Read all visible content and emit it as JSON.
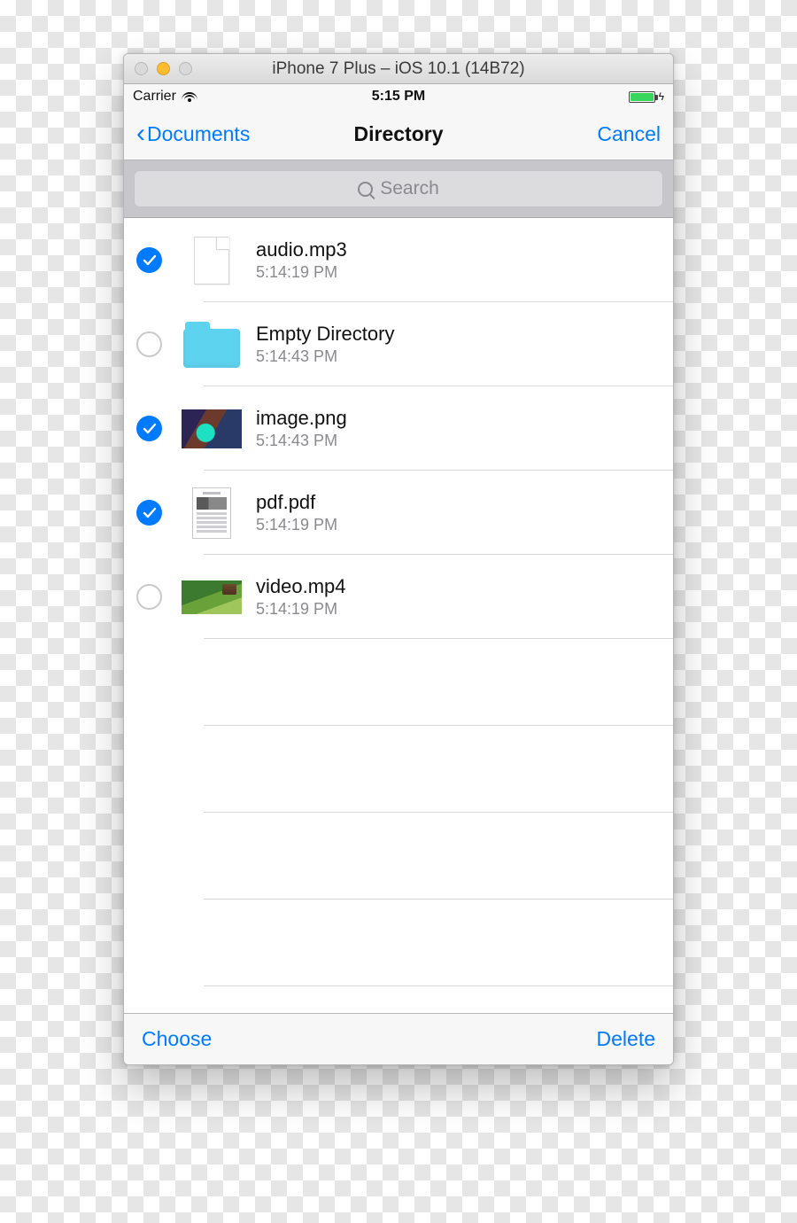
{
  "simulator": {
    "title": "iPhone 7 Plus – iOS 10.1 (14B72)"
  },
  "status": {
    "carrier": "Carrier",
    "time": "5:15 PM"
  },
  "nav": {
    "back_label": "Documents",
    "title": "Directory",
    "right_action": "Cancel"
  },
  "search": {
    "placeholder": "Search"
  },
  "files": [
    {
      "name": "audio.mp3",
      "time": "5:14:19 PM",
      "selected": true,
      "thumb": "file"
    },
    {
      "name": "Empty Directory",
      "time": "5:14:43 PM",
      "selected": false,
      "thumb": "folder"
    },
    {
      "name": "image.png",
      "time": "5:14:43 PM",
      "selected": true,
      "thumb": "image"
    },
    {
      "name": "pdf.pdf",
      "time": "5:14:19 PM",
      "selected": true,
      "thumb": "pdf"
    },
    {
      "name": "video.mp4",
      "time": "5:14:19 PM",
      "selected": false,
      "thumb": "video"
    }
  ],
  "toolbar": {
    "choose": "Choose",
    "delete": "Delete"
  }
}
